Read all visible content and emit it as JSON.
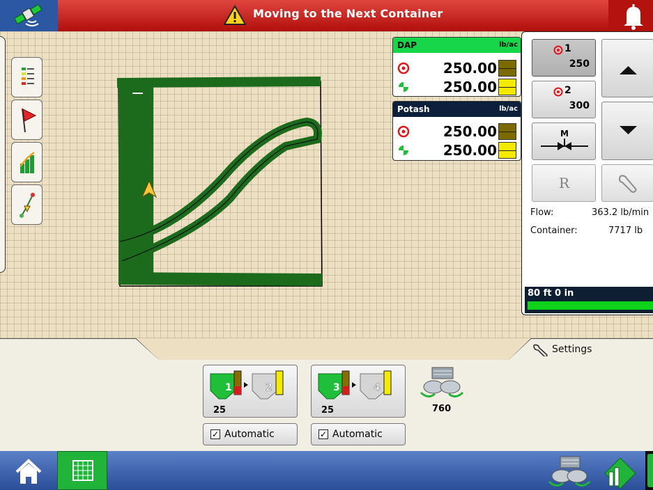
{
  "alert": {
    "title": "Moving to the Next Container"
  },
  "products": [
    {
      "name": "DAP",
      "unit": "lb/ac",
      "target_rate": "250.00",
      "actual_rate": "250.00",
      "header_color": "#18d64a"
    },
    {
      "name": "Potash",
      "unit": "lb/ac",
      "target_rate": "250.00",
      "actual_rate": "250.00",
      "header_color": "#0c1f3b"
    }
  ],
  "rate_presets": [
    {
      "label": "1",
      "value": "250"
    },
    {
      "label": "2",
      "value": "300"
    }
  ],
  "manual_button_label": "M",
  "prescription_label": "R",
  "info": {
    "flow_label": "Flow:",
    "flow_value": "363.2 lb/min",
    "container_label": "Container:",
    "container_value": "7717 lb"
  },
  "implement_width": "80 ft 0 in",
  "settings_label": "Settings",
  "sections": [
    {
      "a": "1",
      "b": "2",
      "count": "25",
      "automatic_label": "Automatic"
    },
    {
      "a": "3",
      "b": "4",
      "count": "25",
      "automatic_label": "Automatic"
    }
  ],
  "rpm_value": "760",
  "colors": {
    "accent_green": "#21b33a",
    "alert_red": "#c4201b",
    "coverage_green": "#1c6b1c"
  }
}
